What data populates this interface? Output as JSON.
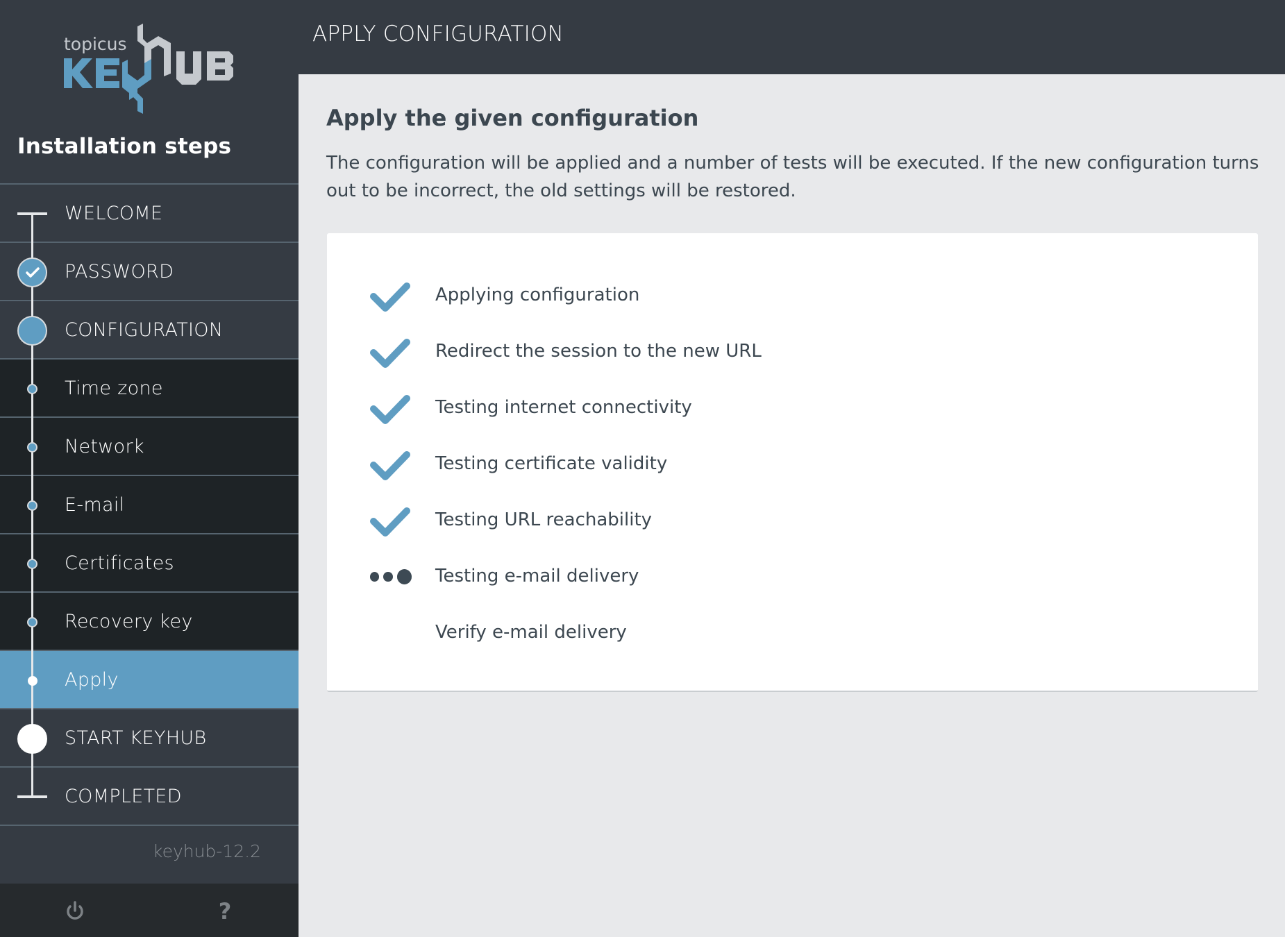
{
  "logo": {
    "brand_small": "topicus",
    "brand_left": "KE",
    "brand_right": "UB",
    "colors": {
      "blue": "#5f9dc2",
      "grey": "#c5c9ce"
    }
  },
  "sidebar": {
    "title": "Installation steps",
    "steps": [
      {
        "label": "WELCOME",
        "kind": "start-bar",
        "level": "main",
        "state": "done"
      },
      {
        "label": "PASSWORD",
        "kind": "circle-check",
        "level": "main",
        "state": "done"
      },
      {
        "label": "CONFIGURATION",
        "kind": "circle",
        "level": "main",
        "state": "current"
      },
      {
        "label": "Time zone",
        "kind": "dot",
        "level": "sub",
        "state": "done"
      },
      {
        "label": "Network",
        "kind": "dot",
        "level": "sub",
        "state": "done"
      },
      {
        "label": "E-mail",
        "kind": "dot",
        "level": "sub",
        "state": "done"
      },
      {
        "label": "Certificates",
        "kind": "dot",
        "level": "sub",
        "state": "done"
      },
      {
        "label": "Recovery key",
        "kind": "dot",
        "level": "sub",
        "state": "done"
      },
      {
        "label": "Apply",
        "kind": "dot",
        "level": "sub",
        "state": "active"
      },
      {
        "label": "START KEYHUB",
        "kind": "circle-white",
        "level": "main",
        "state": "pending"
      },
      {
        "label": "COMPLETED",
        "kind": "end-bar",
        "level": "main",
        "state": "pending"
      }
    ],
    "version": "keyhub-12.2",
    "footer": {
      "power_icon": "power-icon",
      "help_label": "?"
    }
  },
  "header": {
    "title": "APPLY CONFIGURATION"
  },
  "main": {
    "heading": "Apply the given configuration",
    "description": "The configuration will be applied and a number of tests will be executed. If the new configuration turns out to be incorrect, the old settings will be restored.",
    "tasks": [
      {
        "label": "Applying configuration",
        "status": "done",
        "icon": "check-icon"
      },
      {
        "label": "Redirect the session to the new URL",
        "status": "done",
        "icon": "check-icon"
      },
      {
        "label": "Testing internet connectivity",
        "status": "done",
        "icon": "check-icon"
      },
      {
        "label": "Testing certificate validity",
        "status": "done",
        "icon": "check-icon"
      },
      {
        "label": "Testing URL reachability",
        "status": "done",
        "icon": "check-icon"
      },
      {
        "label": "Testing e-mail delivery",
        "status": "in-progress",
        "icon": "loading-dots-icon"
      },
      {
        "label": "Verify e-mail delivery",
        "status": "pending",
        "icon": ""
      }
    ]
  },
  "colors": {
    "accent": "#5f9dc2",
    "sidebar_bg": "#353b43",
    "sub_step_bg": "#1e2326",
    "main_bg": "#e8e9eb",
    "text": "#3c4750"
  }
}
